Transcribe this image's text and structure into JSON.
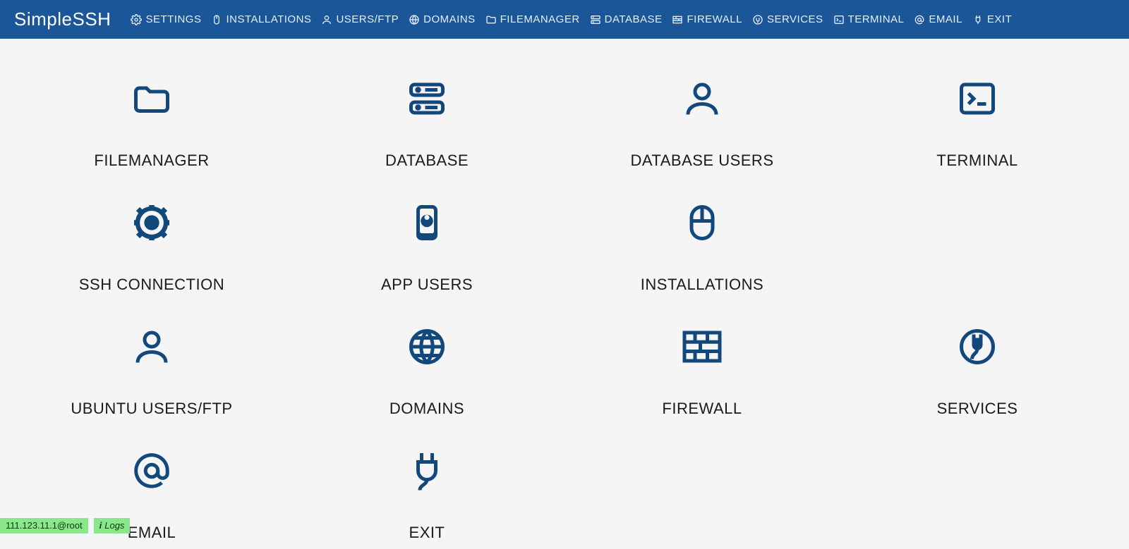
{
  "brand": "SimpleSSH",
  "nav": [
    {
      "label": "SETTINGS"
    },
    {
      "label": "INSTALLATIONS"
    },
    {
      "label": "USERS/FTP"
    },
    {
      "label": "DOMAINS"
    },
    {
      "label": "FILEMANAGER"
    },
    {
      "label": "DATABASE"
    },
    {
      "label": "FIREWALL"
    },
    {
      "label": "SERVICES"
    },
    {
      "label": "TERMINAL"
    },
    {
      "label": "EMAIL"
    },
    {
      "label": "EXIT"
    }
  ],
  "tiles": [
    {
      "label": "FILEMANAGER"
    },
    {
      "label": "DATABASE"
    },
    {
      "label": "DATABASE USERS"
    },
    {
      "label": "TERMINAL"
    },
    {
      "label": "SSH CONNECTION"
    },
    {
      "label": "APP USERS"
    },
    {
      "label": "INSTALLATIONS"
    },
    {
      "label": ""
    },
    {
      "label": "UBUNTU USERS/FTP"
    },
    {
      "label": "DOMAINS"
    },
    {
      "label": "FIREWALL"
    },
    {
      "label": "SERVICES"
    },
    {
      "label": "EMAIL"
    },
    {
      "label": "EXIT"
    }
  ],
  "status": {
    "connection": "111.123.11.1@root",
    "logs_prefix": "i",
    "logs_label": "Logs"
  }
}
